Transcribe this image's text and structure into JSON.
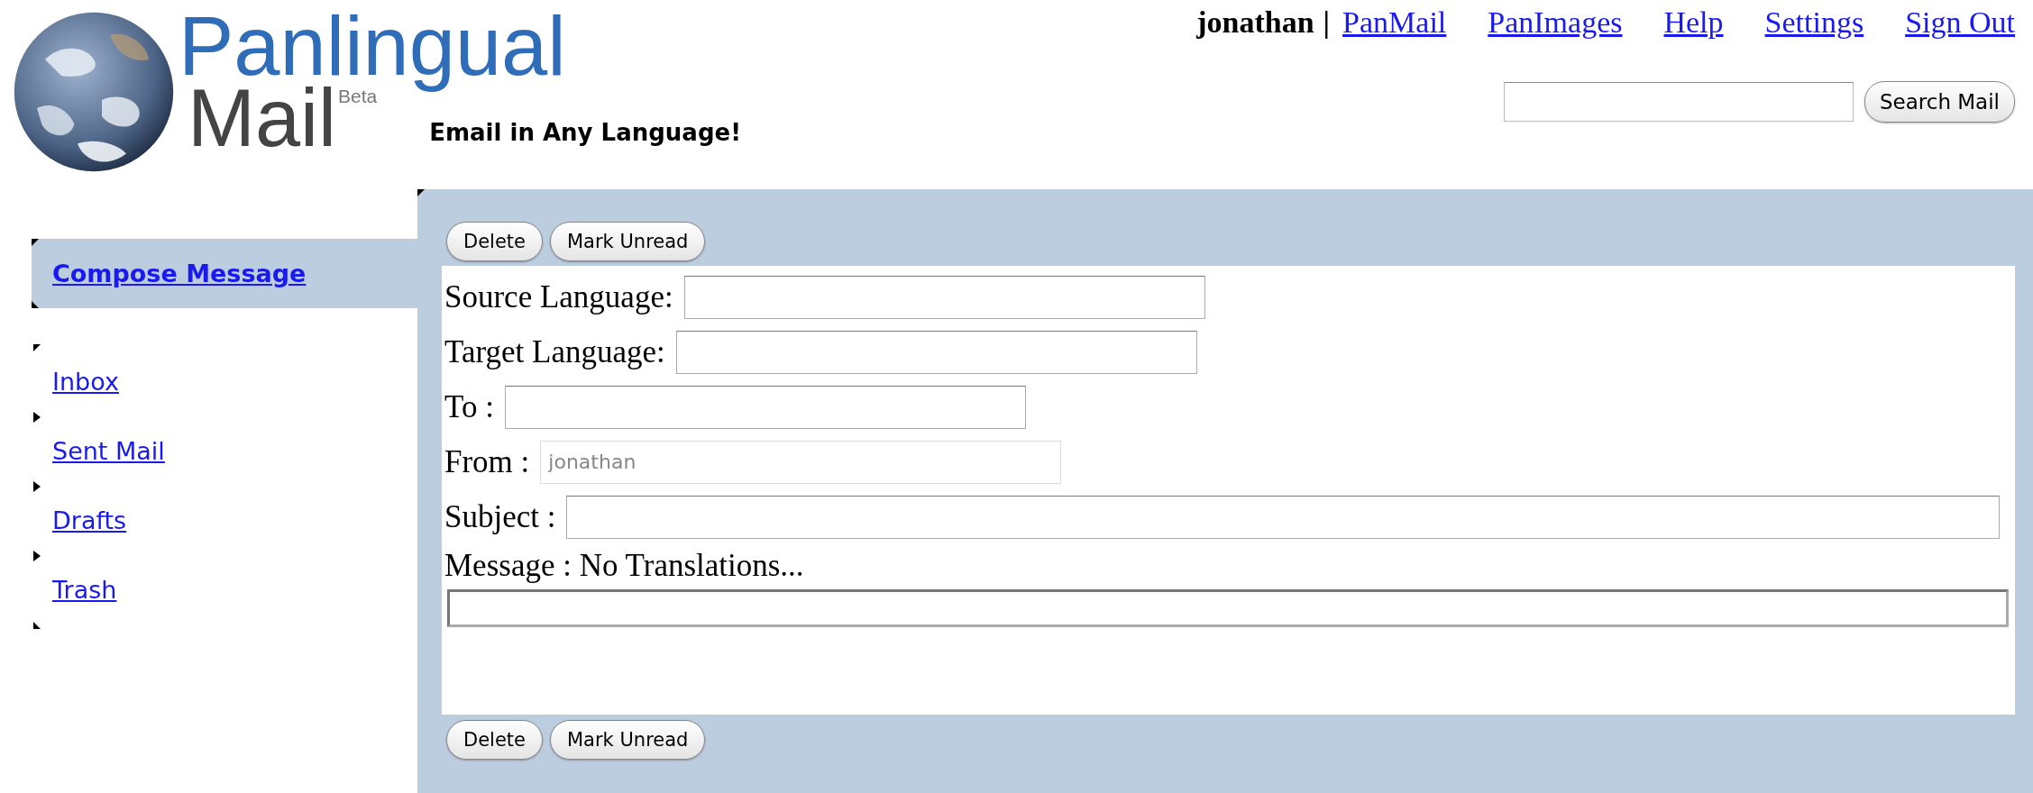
{
  "logo": {
    "title": "Panlingual",
    "subtitle": "Mail",
    "badge": "Beta"
  },
  "tagline": "Email in Any Language!",
  "user": {
    "name": "jonathan",
    "separator": "|"
  },
  "nav_links": [
    "PanMail",
    "PanImages",
    "Help",
    "Settings",
    "Sign Out"
  ],
  "search": {
    "button": "Search Mail"
  },
  "sidebar": {
    "compose": "Compose Message",
    "items": [
      {
        "label": "Inbox"
      },
      {
        "label": "Sent Mail"
      },
      {
        "label": "Drafts"
      },
      {
        "label": "Trash"
      }
    ]
  },
  "toolbar_top": [
    "Delete",
    "Mark Unread"
  ],
  "form": {
    "fields": [
      {
        "label": "Source Language:",
        "disabled": false
      },
      {
        "label": "Target Language:",
        "disabled": false
      },
      {
        "label": "To :",
        "disabled": false
      },
      {
        "label": "From :",
        "value": "jonathan",
        "disabled": true
      },
      {
        "label": "Subject :",
        "disabled": false
      }
    ],
    "message_label": "Message : No Translations..."
  },
  "toolbar_bottom": [
    "Delete",
    "Mark Unread"
  ]
}
